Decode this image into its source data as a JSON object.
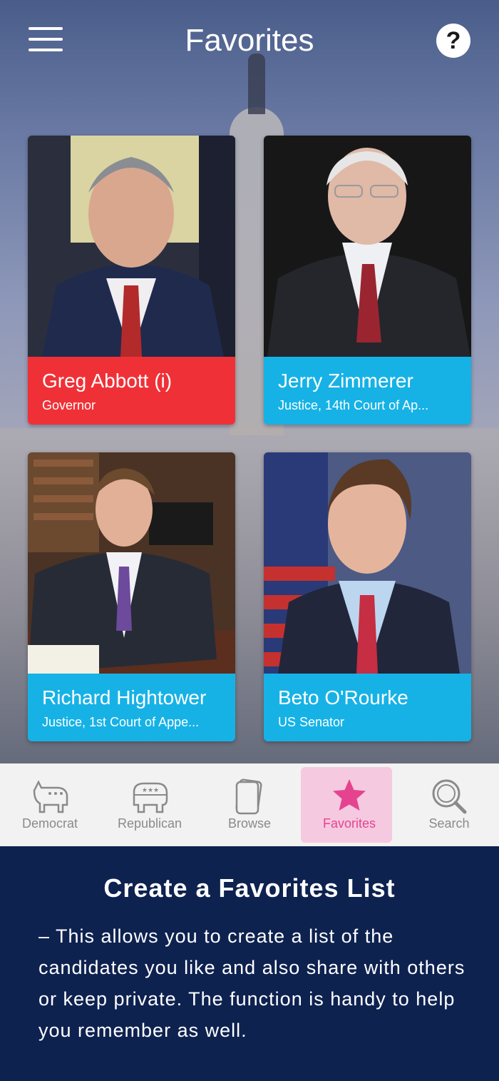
{
  "header": {
    "title": "Favorites"
  },
  "icons": {
    "menu": "hamburger-menu-icon",
    "help": "question-mark-icon",
    "help_glyph": "?"
  },
  "candidates": [
    {
      "name": "Greg Abbott (i)",
      "role": "Governor",
      "party_color": "#ef3137"
    },
    {
      "name": "Jerry Zimmerer",
      "role": "Justice, 14th Court of Ap...",
      "party_color": "#16b2e6"
    },
    {
      "name": "Richard Hightower",
      "role": "Justice, 1st Court of Appe...",
      "party_color": "#16b2e6"
    },
    {
      "name": "Beto O'Rourke",
      "role": "US Senator",
      "party_color": "#16b2e6"
    }
  ],
  "tabs": [
    {
      "label": "Democrat",
      "icon": "donkey-icon"
    },
    {
      "label": "Republican",
      "icon": "elephant-icon"
    },
    {
      "label": "Browse",
      "icon": "cards-icon"
    },
    {
      "label": "Favorites",
      "icon": "star-icon",
      "active": true
    },
    {
      "label": "Search",
      "icon": "magnifier-icon"
    }
  ],
  "promo": {
    "heading": "Create a Favorites List",
    "body": "– This allows you to create a list of the candidates you like and also share with others or keep private. The function is handy to help you remember as well."
  },
  "colors": {
    "accent_pink": "#e5438f",
    "navy": "#0e2250",
    "red": "#ef3137",
    "blue": "#16b2e6"
  }
}
